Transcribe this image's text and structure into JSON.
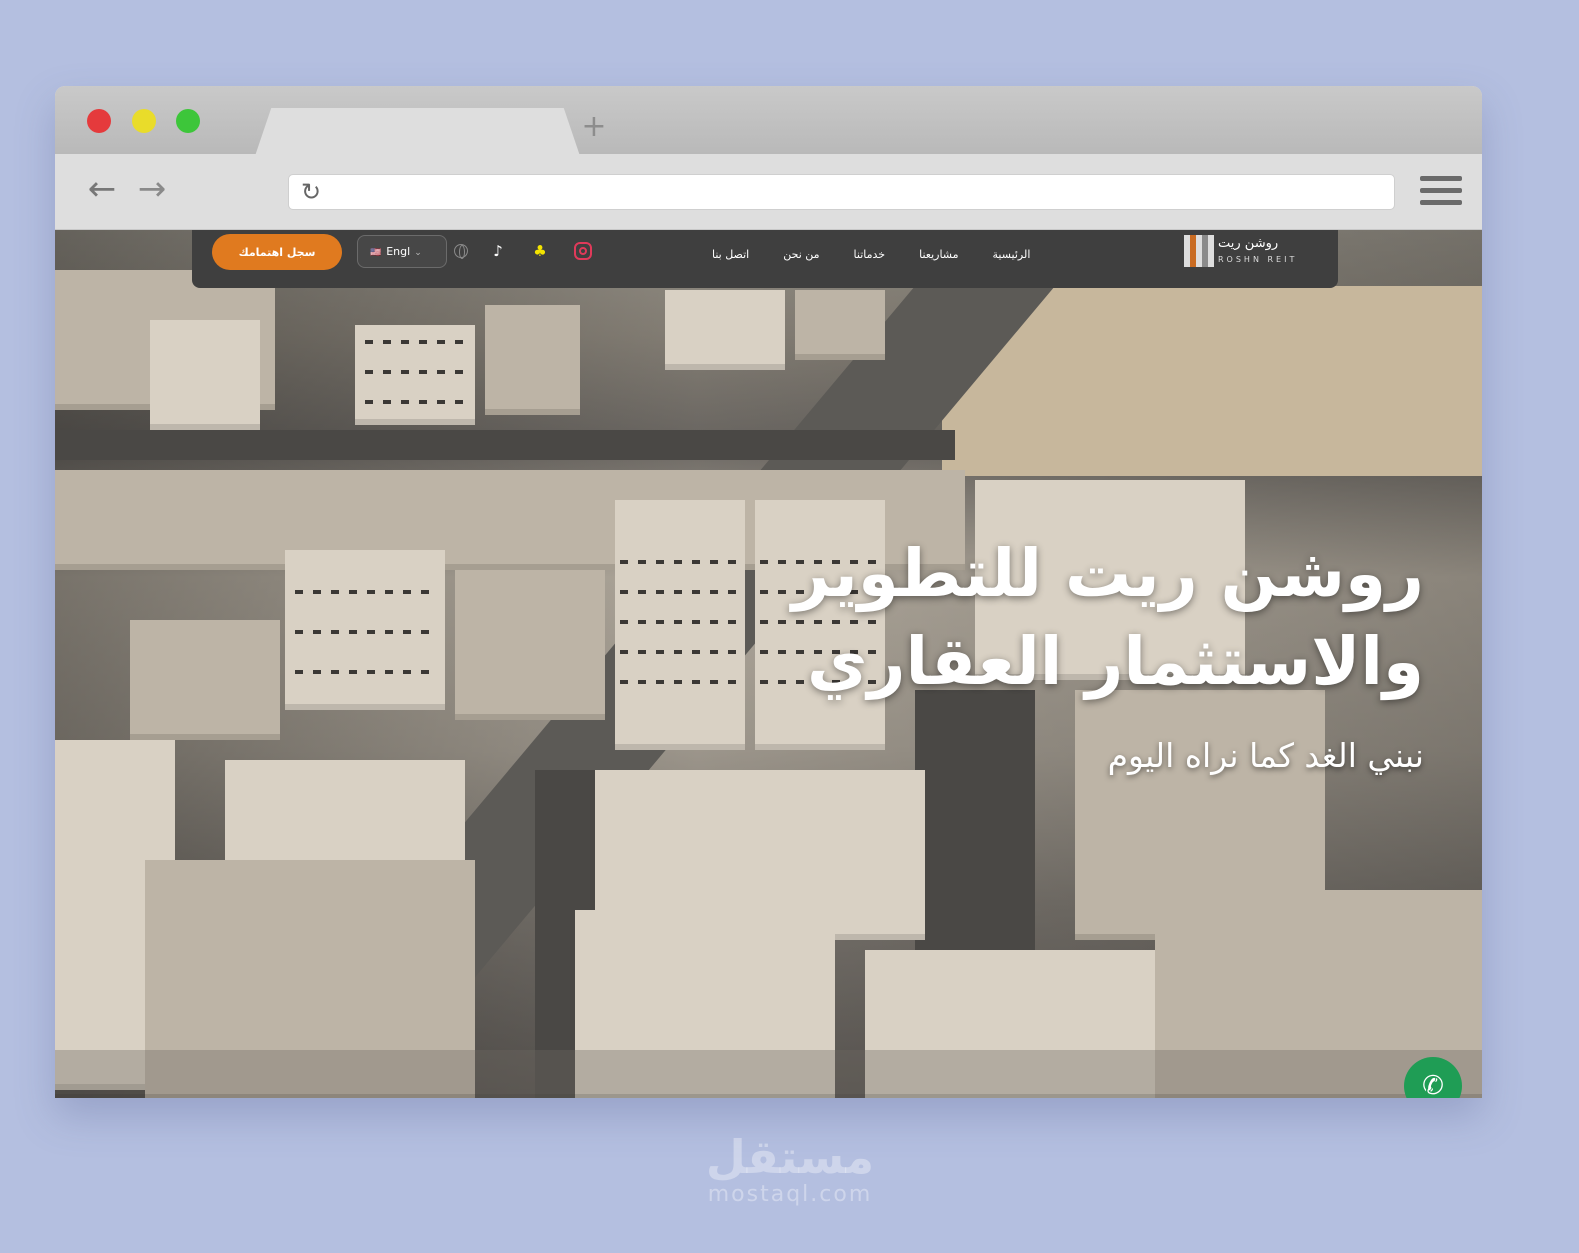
{
  "browser": {
    "new_tab_glyph": "+",
    "back_glyph": "←",
    "forward_glyph": "→",
    "reload_glyph": "↻",
    "address_value": ""
  },
  "site": {
    "nav": {
      "register_label": "سجل اهتمامك",
      "language_label": "Engl",
      "language_flag": "🇺🇸",
      "links": [
        "الرئيسية",
        "مشاريعنا",
        "خدماتنا",
        "من نحن",
        "اتصل بنا"
      ]
    },
    "logo": {
      "ar": "روشن ريت",
      "en": "ROSHN REIT"
    },
    "hero": {
      "title_line1": "روشن ريت للتطوير",
      "title_line2": "والاستثمار العقاري",
      "subtitle": "نبني الغد كما نراه اليوم"
    },
    "whatsapp_glyph": "✆"
  },
  "watermark": {
    "ar": "مستقل",
    "en": "mostaql.com"
  },
  "colors": {
    "page_background": "#b4bfe0",
    "accent_orange": "#e07a1f",
    "nav_background": "#3f3f3f",
    "whatsapp_green": "#1f9d55"
  }
}
